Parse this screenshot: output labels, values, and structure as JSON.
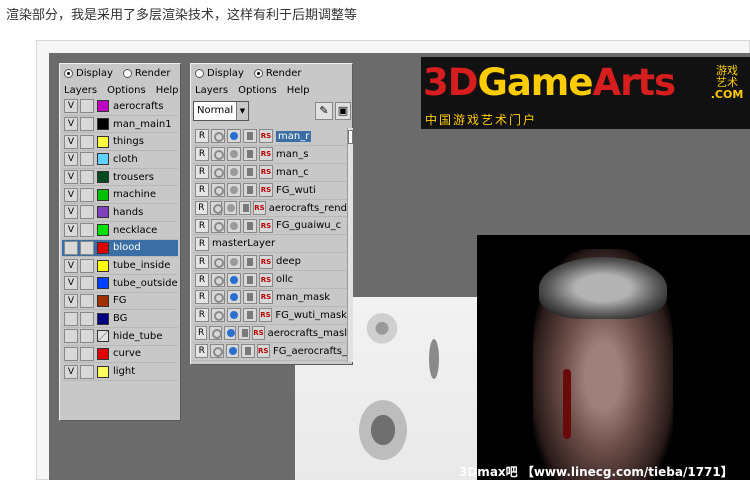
{
  "caption": "渲染部分，我是采用了多层渲染技术，这样有利于后期调整等",
  "display_panel": {
    "radio_display": "Display",
    "radio_render": "Render",
    "selected_radio": "Display",
    "menu": [
      "Layers",
      "Options",
      "Help"
    ],
    "layers": [
      {
        "v": "V",
        "name": "aerocrafts",
        "color": "#c000c0"
      },
      {
        "v": "V",
        "name": "man_main1",
        "color": "#000000"
      },
      {
        "v": "V",
        "name": "things",
        "color": "#ffff40"
      },
      {
        "v": "V",
        "name": "cloth",
        "color": "#60d0ff"
      },
      {
        "v": "V",
        "name": "trousers",
        "color": "#004a20"
      },
      {
        "v": "V",
        "name": "machine",
        "color": "#00c000"
      },
      {
        "v": "V",
        "name": "hands",
        "color": "#8040c0"
      },
      {
        "v": "V",
        "name": "necklace",
        "color": "#00e000"
      },
      {
        "v": "",
        "name": "blood",
        "color": "#e00000",
        "selected": true
      },
      {
        "v": "V",
        "name": "tube_inside",
        "color": "#ffff00"
      },
      {
        "v": "V",
        "name": "tube_outside",
        "color": "#0040ff"
      },
      {
        "v": "V",
        "name": "FG",
        "color": "#a03000"
      },
      {
        "v": "",
        "name": "BG",
        "color": "#000080"
      },
      {
        "v": "",
        "name": "hide_tube",
        "color": "#d0d0d0"
      },
      {
        "v": "",
        "name": "curve",
        "color": "#e00000"
      },
      {
        "v": "V",
        "name": "light",
        "color": "#ffff60"
      }
    ]
  },
  "render_panel": {
    "radio_display": "Display",
    "radio_render": "Render",
    "selected_radio": "Render",
    "menu": [
      "Layers",
      "Options",
      "Help"
    ],
    "blend_mode": "Normal",
    "layers": [
      {
        "name": "man_r",
        "ball": true,
        "selected": true
      },
      {
        "name": "man_s",
        "ball": false
      },
      {
        "name": "man_c",
        "ball": false
      },
      {
        "name": "FG_wuti",
        "ball": false
      },
      {
        "name": "aerocrafts_rend",
        "ball": false
      },
      {
        "name": "FG_guaiwu_c",
        "ball": false
      },
      {
        "name": "masterLayer",
        "master": true
      },
      {
        "name": "deep",
        "ball": false
      },
      {
        "name": "ollc",
        "ball": true
      },
      {
        "name": "man_mask",
        "ball": true
      },
      {
        "name": "FG_wuti_mask",
        "ball": true
      },
      {
        "name": "aerocrafts_masl",
        "ball": true
      },
      {
        "name": "FG_aerocrafts_",
        "ball": true
      }
    ]
  },
  "logo": {
    "text_red_1": "3D",
    "text_yellow": "Game",
    "text_red_2": "Arts",
    "side_1": "游戏",
    "side_2": "艺术",
    "side_com": ".COM",
    "subtitle": "中国游戏艺术门户"
  },
  "watermark": "3Dmax吧 【www.linecg.com/tieba/1771】"
}
